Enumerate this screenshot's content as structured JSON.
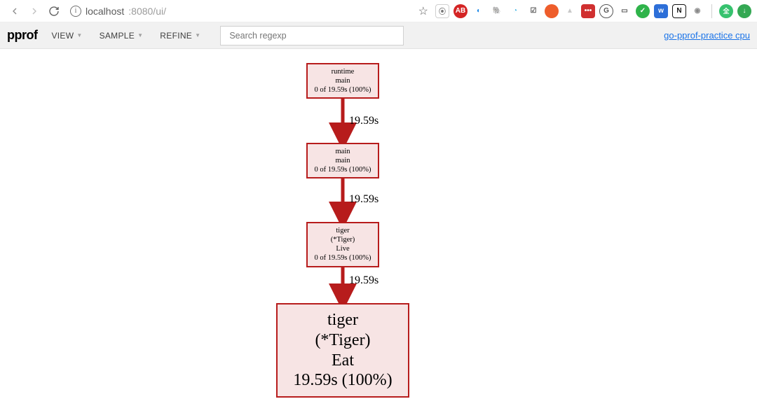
{
  "browser": {
    "url_host": "localhost",
    "url_port_path": ":8080/ui/"
  },
  "pprof": {
    "logo": "pprof",
    "view": "VIEW",
    "sample": "SAMPLE",
    "refine": "REFINE",
    "search_placeholder": "Search regexp",
    "profile_link": "go-pprof-practice cpu"
  },
  "graph": {
    "nodes": {
      "n0": {
        "l1": "runtime",
        "l2": "main",
        "l3": "0 of 19.59s (100%)"
      },
      "n1": {
        "l1": "main",
        "l2": "main",
        "l3": "0 of 19.59s (100%)"
      },
      "n2": {
        "l1": "tiger",
        "l2": "(*Tiger)",
        "l3": "Live",
        "l4": "0 of 19.59s (100%)"
      },
      "n3": {
        "l1": "tiger",
        "l2": "(*Tiger)",
        "l3": "Eat",
        "l4": "19.59s (100%)"
      }
    },
    "edges": {
      "e0": "19.59s",
      "e1": "19.59s",
      "e2": "19.59s"
    }
  }
}
